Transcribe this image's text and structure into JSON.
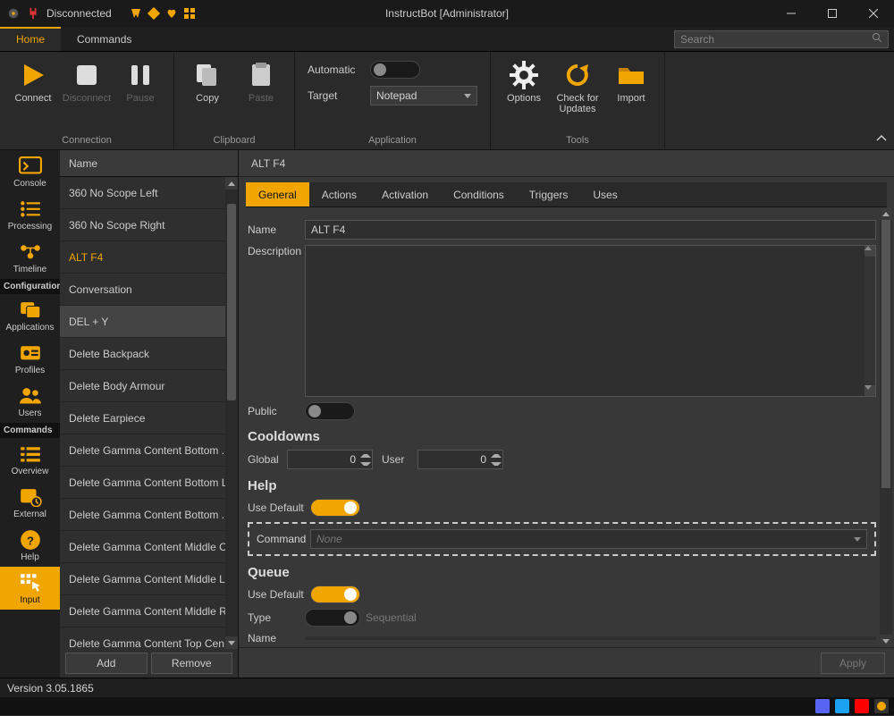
{
  "window": {
    "title": "InstructBot [Administrator]",
    "status": "Disconnected"
  },
  "tabs": {
    "home": "Home",
    "commands": "Commands"
  },
  "search": {
    "placeholder": "Search"
  },
  "ribbon": {
    "connection": {
      "label": "Connection",
      "connect": "Connect",
      "disconnect": "Disconnect",
      "pause": "Pause"
    },
    "clipboard": {
      "label": "Clipboard",
      "copy": "Copy",
      "paste": "Paste"
    },
    "application": {
      "label": "Application",
      "automatic": "Automatic",
      "target": "Target",
      "target_value": "Notepad"
    },
    "tools": {
      "label": "Tools",
      "options": "Options",
      "check": "Check for Updates",
      "import": "Import"
    }
  },
  "nav": {
    "console": "Console",
    "processing": "Processing",
    "timeline": "Timeline",
    "configuration": "Configuration",
    "applications": "Applications",
    "profiles": "Profiles",
    "users": "Users",
    "commands": "Commands",
    "overview": "Overview",
    "external": "External",
    "help": "Help",
    "input": "Input"
  },
  "list": {
    "header": "Name",
    "items": [
      "360 No Scope Left",
      "360 No Scope Right",
      "ALT F4",
      "Conversation",
      "DEL + Y",
      "Delete Backpack",
      "Delete Body Armour",
      "Delete Earpiece",
      "Delete Gamma Content Bottom ...",
      "Delete Gamma Content Bottom L...",
      "Delete Gamma Content Bottom ...",
      "Delete Gamma Content Middle C...",
      "Delete Gamma Content Middle L...",
      "Delete Gamma Content Middle Ri...",
      "Delete Gamma Content Top Cen..."
    ],
    "selected": "ALT F4",
    "hover": "DEL + Y",
    "add": "Add",
    "remove": "Remove"
  },
  "detail": {
    "title": "ALT F4",
    "tabs": {
      "general": "General",
      "actions": "Actions",
      "activation": "Activation",
      "conditions": "Conditions",
      "triggers": "Triggers",
      "uses": "Uses"
    },
    "fields": {
      "name_label": "Name",
      "name_value": "ALT F4",
      "description_label": "Description",
      "public_label": "Public",
      "cooldowns_header": "Cooldowns",
      "global_label": "Global",
      "global_value": "0",
      "user_label": "User",
      "user_value": "0",
      "help_header": "Help",
      "use_default_label": "Use Default",
      "command_label": "Command",
      "command_placeholder": "None",
      "queue_header": "Queue",
      "type_label": "Type",
      "type_hint": "Sequential",
      "name2_label": "Name"
    },
    "apply": "Apply"
  },
  "status": {
    "version": "Version 3.05.1865"
  },
  "tray": {
    "colors": [
      "#5865F2",
      "#1DA1F2",
      "#FF0000",
      "#f0a500"
    ]
  }
}
